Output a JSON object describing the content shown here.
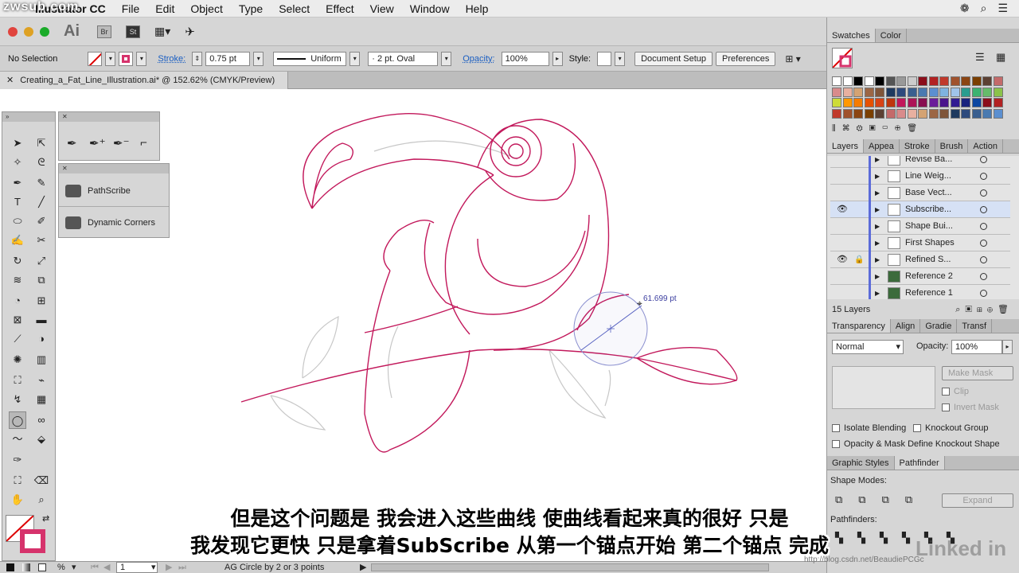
{
  "watermark_top": "zwsub.com",
  "watermark_bottom": "http://blog.csdn.net/BeaudiePCGc",
  "brand": "Linked in",
  "menubar": {
    "app": "Illustrator CC",
    "items": [
      "File",
      "Edit",
      "Object",
      "Type",
      "Select",
      "Effect",
      "View",
      "Window",
      "Help"
    ]
  },
  "appbar": {
    "logo": "Ai",
    "br": "Br",
    "st": "St"
  },
  "control_bar": {
    "selection": "No Selection",
    "stroke_label": "Stroke:",
    "stroke_value": "0.75 pt",
    "profile": "Uniform",
    "brush": "2 pt. Oval",
    "opacity_label": "Opacity:",
    "opacity_value": "100%",
    "style_label": "Style:",
    "document_setup": "Document Setup",
    "preferences": "Preferences"
  },
  "document_tab": "Creating_a_Fat_Line_Illustration.ai* @ 152.62% (CMYK/Preview)",
  "plugins": {
    "items": [
      "PathScribe",
      "Dynamic Corners"
    ]
  },
  "canvas": {
    "measure_readout": "61.699 pt"
  },
  "swatches_panel": {
    "tabs": [
      "Swatches",
      "Color"
    ],
    "colors": [
      "#8b0e1a",
      "#b22222",
      "#c0392b",
      "#a0522d",
      "#8b4513",
      "#7b3f00",
      "#5c4033",
      "#c46a6a",
      "#d98b8b",
      "#e8b0a0",
      "#d4a373",
      "#9c6644",
      "#7f5539",
      "#1f3a5f",
      "#2e4a7d",
      "#3a5f8f",
      "#4a7ab0",
      "#5b8fd0",
      "#7fb3e0",
      "#a0c4ea",
      "#2a9d8f",
      "#3cb371",
      "#66bb6a",
      "#8bc34a",
      "#cddc39",
      "#ff9800",
      "#f57c00",
      "#e65100",
      "#d84315",
      "#bf360c",
      "#c2185b",
      "#ad1457",
      "#880e4f",
      "#6a1b9a",
      "#4a148c",
      "#311b92",
      "#1a237e",
      "#0d47a1"
    ]
  },
  "layers_panel": {
    "tabs": [
      "Layers",
      "Appea",
      "Stroke",
      "Brush",
      "Action"
    ],
    "layers": [
      {
        "name": "Revise Ba...",
        "eye": false,
        "lock": false,
        "selected": false
      },
      {
        "name": "Line Weig...",
        "eye": false,
        "lock": false,
        "selected": false
      },
      {
        "name": "Base Vect...",
        "eye": false,
        "lock": false,
        "selected": false
      },
      {
        "name": "Subscribe...",
        "eye": true,
        "lock": false,
        "selected": true
      },
      {
        "name": "Shape Bui...",
        "eye": false,
        "lock": false,
        "selected": false
      },
      {
        "name": "First Shapes",
        "eye": false,
        "lock": false,
        "selected": false
      },
      {
        "name": "Refined S...",
        "eye": true,
        "lock": true,
        "selected": false
      },
      {
        "name": "Reference 2",
        "eye": false,
        "lock": false,
        "selected": false
      },
      {
        "name": "Reference 1",
        "eye": false,
        "lock": false,
        "selected": false
      }
    ],
    "count": "15 Layers"
  },
  "transparency_panel": {
    "tabs": [
      "Transparency",
      "Align",
      "Gradie",
      "Transf"
    ],
    "blend_mode": "Normal",
    "opacity_label": "Opacity:",
    "opacity_value": "100%",
    "make_mask": "Make Mask",
    "clip": "Clip",
    "invert_mask": "Invert Mask",
    "isolate_blending": "Isolate Blending",
    "knockout_group": "Knockout Group",
    "opacity_mask_knockout": "Opacity & Mask Define Knockout Shape"
  },
  "pathfinder_panel": {
    "tabs": [
      "Graphic Styles",
      "Pathfinder"
    ],
    "shape_modes": "Shape Modes:",
    "expand": "Expand",
    "pathfinders": "Pathfinders:"
  },
  "status_bar": {
    "zoom": "%",
    "artboard": "1",
    "tool_status": "AG Circle by 2 or 3 points"
  },
  "subtitles": {
    "line1": "但是这个问题是  我会进入这些曲线  使曲线看起来真的很好  只是",
    "line2": "我发现它更快  只是拿着SubScribe  从第一个锚点开始  第二个锚点  完成"
  }
}
